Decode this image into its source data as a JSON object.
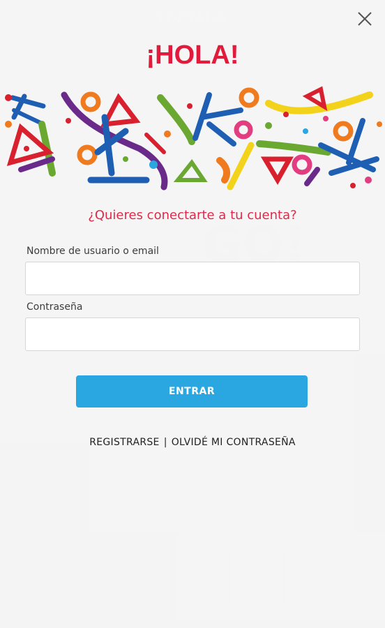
{
  "background": {
    "header_title": "PORTADA"
  },
  "dialog": {
    "greeting": "¡HOLA!",
    "question": "¿Quieres conectarte a tu cuenta?",
    "username_label": "Nombre de usuario o email",
    "username_value": "",
    "password_label": "Contraseña",
    "password_value": "",
    "submit_label": "ENTRAR",
    "register_link": "REGISTRARSE",
    "separator": "|",
    "forgot_link": "OLVIDÉ MI CONTRASEÑA"
  },
  "icons": {
    "close": "close-icon",
    "doodle": "confetti-doodle-icon"
  },
  "colors": {
    "accent_red": "#e01b3c",
    "button_blue": "#2aa6e0",
    "overlay_bg": "#f4f4f4"
  }
}
